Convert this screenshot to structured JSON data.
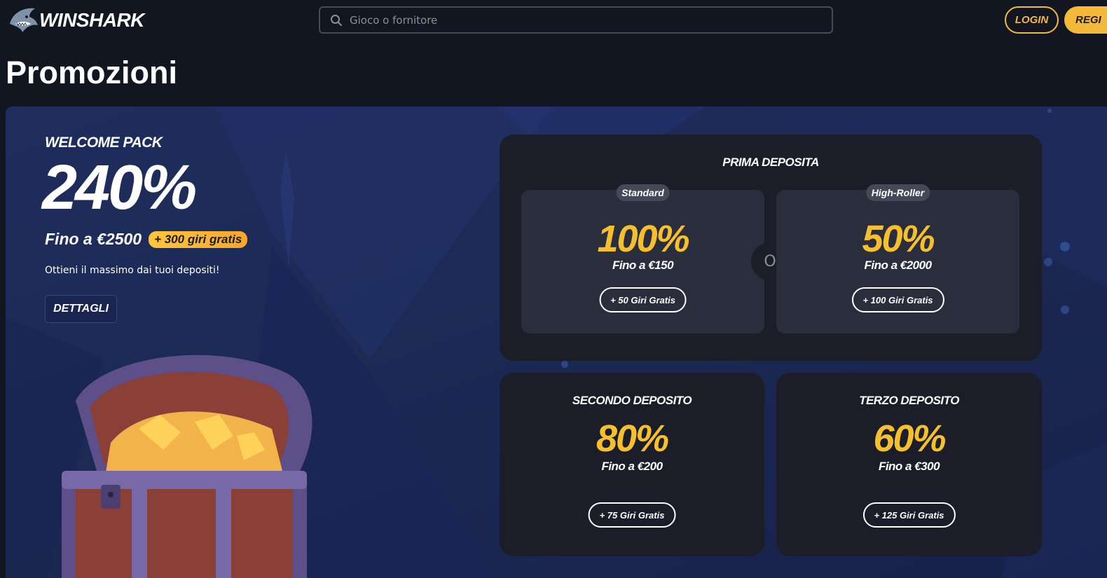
{
  "header": {
    "brand": "WINSHARK",
    "search_placeholder": "Gioco o fornitore",
    "login_label": "LOGIN",
    "register_label": "REGI"
  },
  "page": {
    "title": "Promozioni"
  },
  "welcome": {
    "label": "WELCOME PACK",
    "percent": "240%",
    "amount": "Fino a €2500",
    "spins_badge": "+ 300 giri gratis",
    "description": "Ottieni il massimo dai tuoi depositi!",
    "details_label": "DETTAGLI"
  },
  "first_deposit": {
    "title": "PRIMA DEPOSITA",
    "or_label": "O",
    "options": [
      {
        "tag": "Standard",
        "percent": "100%",
        "upto": "Fino a €150",
        "spins": "+ 50 Giri Gratis"
      },
      {
        "tag": "High-Roller",
        "percent": "50%",
        "upto": "Fino a €2000",
        "spins": "+ 100 Giri Gratis"
      }
    ]
  },
  "second_deposit": {
    "title": "SECONDO DEPOSITO",
    "percent": "80%",
    "upto": "Fino a €200",
    "spins": "+ 75 Giri Gratis"
  },
  "third_deposit": {
    "title": "TERZO DEPOSITO",
    "percent": "60%",
    "upto": "Fino a €300",
    "spins": "+ 125 Giri Gratis"
  },
  "colors": {
    "accent": "#f5b93a",
    "percent_yellow": "#f5c02c",
    "card_bg": "#1b1e29",
    "subcard_bg": "#2a2d3b",
    "page_bg": "#111621",
    "banner_bg": "#1f2d5e"
  },
  "icons": {
    "logo": "shark-logo-icon",
    "search": "search-icon"
  }
}
